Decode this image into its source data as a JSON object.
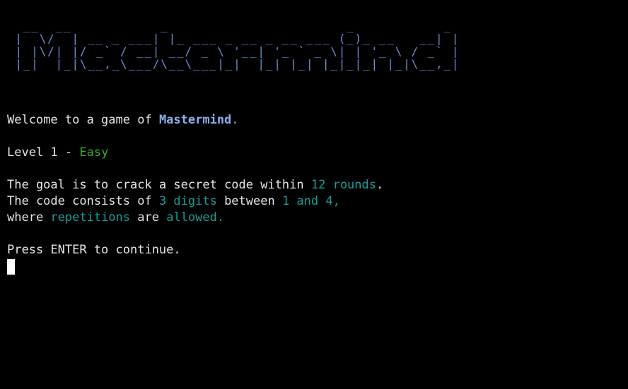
{
  "colors": {
    "background": "#000000",
    "text": "#e6e6e6",
    "banner": "#6a8fd8",
    "title": "#8eb0f0",
    "level": "#3fa92a",
    "highlight": "#1b9e98"
  },
  "banner": {
    "ascii_art": "  __  __           _                      _           _ \n |  \\/  | __ _ ___| |_ ___ _ __ _ __ ___ (_)_ __   __| |\n | |\\/| |/ _` / __| __/ _ \\ '__| '_ ` _ \\| | '_ \\ / _` |\n |_|  |_|\\__,_\\___/\\__\\___|_|  |_| |_| |_|_|_| |_|\\__,_|"
  },
  "welcome": {
    "prefix": "Welcome to a game of ",
    "game_name": "Mastermind",
    "suffix": "."
  },
  "level": {
    "prefix": "Level 1 - ",
    "name": "Easy"
  },
  "rules": {
    "line1_prefix": "The goal is to crack a secret code within ",
    "rounds": "12 rounds",
    "line1_suffix": ".",
    "line2_prefix": "The code consists of ",
    "digits": "3 digits",
    "line2_middle": " between ",
    "range": "1 and 4,",
    "line3_prefix": "where ",
    "repetitions": "repetitions",
    "line3_middle": " are ",
    "allowed": "allowed."
  },
  "prompt": {
    "text": "Press ENTER to continue."
  }
}
